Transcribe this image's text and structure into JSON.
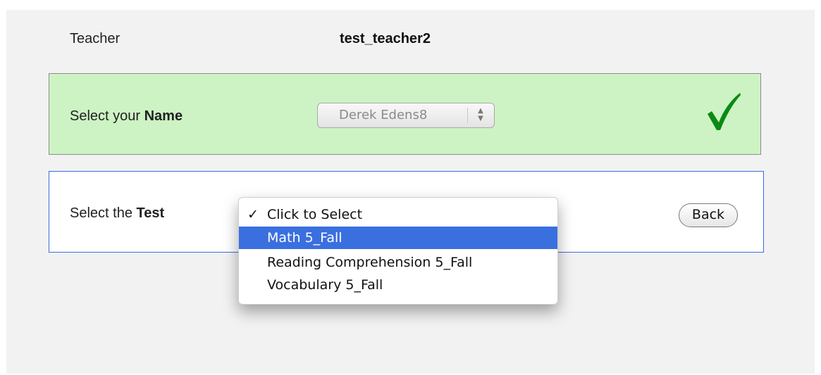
{
  "teacher": {
    "label": "Teacher",
    "value": "test_teacher2"
  },
  "name_section": {
    "label_prefix": "Select your ",
    "label_bold": "Name",
    "selected": "Derek Edens8",
    "status_icon": "checkmark-icon",
    "status_color": "#0a8a14",
    "background": "#cdf3c4"
  },
  "test_section": {
    "label_prefix": "Select the ",
    "label_bold": "Test",
    "back_label": "Back",
    "border_color": "#4169e1",
    "dropdown": {
      "options": [
        {
          "label": "Click to Select",
          "selected": true,
          "highlighted": false
        },
        {
          "label": "Math 5_Fall",
          "selected": false,
          "highlighted": true
        },
        {
          "label": "Reading Comprehension 5_Fall",
          "selected": false,
          "highlighted": false
        },
        {
          "label": "Vocabulary 5_Fall",
          "selected": false,
          "highlighted": false
        }
      ],
      "highlight_color": "#3a6fe0"
    }
  }
}
